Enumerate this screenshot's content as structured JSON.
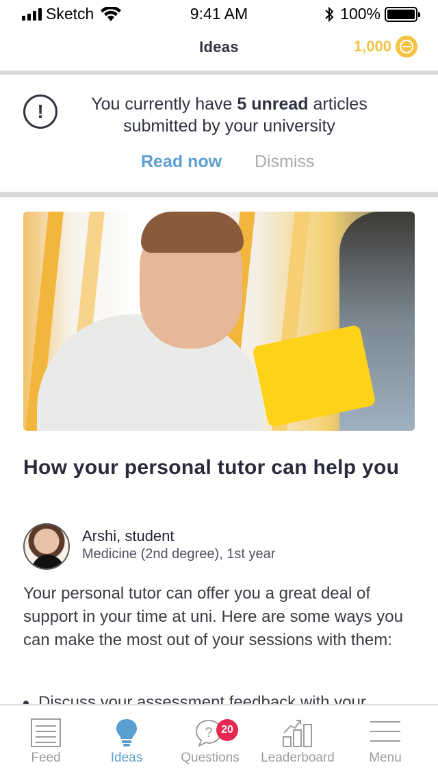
{
  "status_bar": {
    "carrier": "Sketch",
    "time": "9:41 AM",
    "battery": "100%"
  },
  "nav": {
    "title": "Ideas",
    "coins": "1,000",
    "coin_icon": "coin-icon"
  },
  "notice": {
    "text_before": "You currently have ",
    "text_bold": "5 unread",
    "text_after": " articles submitted by your university",
    "read_now": "Read now",
    "dismiss": "Dismiss",
    "icon": "alert-icon"
  },
  "article": {
    "title": "How your personal tutor can help you",
    "author_name": "Arshi, student",
    "author_meta": "Medicine (2nd degree), 1st year",
    "body": "Your personal tutor can offer you a great deal of support in your time at uni. Here are some ways you can make the most out of your sessions with them:",
    "bullet_partial": "Discuss your assessment feedback with your"
  },
  "tabs": [
    {
      "label": "Feed",
      "icon": "feed-icon",
      "active": false
    },
    {
      "label": "Ideas",
      "icon": "lightbulb-icon",
      "active": true
    },
    {
      "label": "Questions",
      "icon": "question-bubble-icon",
      "active": false,
      "badge": "20"
    },
    {
      "label": "Leaderboard",
      "icon": "leaderboard-icon",
      "active": false
    },
    {
      "label": "Menu",
      "icon": "menu-icon",
      "active": false
    }
  ],
  "colors": {
    "accent_blue": "#5a9fd0",
    "coin_gold": "#f3c343",
    "badge_red": "#e6264f",
    "inactive_gray": "#9a9ca2"
  }
}
